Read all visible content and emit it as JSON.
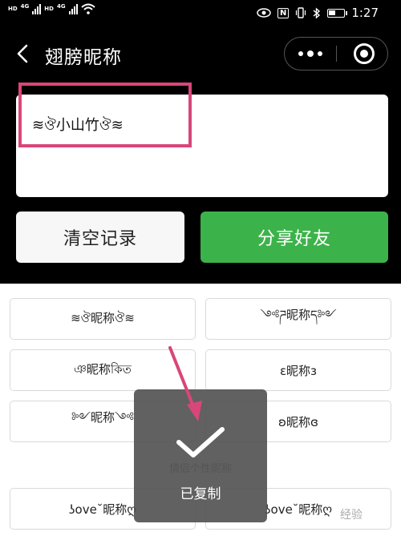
{
  "status_bar": {
    "sim1_hd": "HD",
    "sim1_net": "4G",
    "sim2_hd": "HD",
    "sim2_net": "4G",
    "time": "1:27",
    "nfc": "N"
  },
  "nav": {
    "title": "翅膀昵称"
  },
  "result": {
    "text": "≋ঔ小山竹ঔ≋"
  },
  "buttons": {
    "clear": "清空记录",
    "share": "分享好友"
  },
  "nicknames": [
    "≋ঔ昵称ঔ≋",
    "༺ཌ昵称ད༻",
    "ঞ昵称কিত",
    "ε昵称з",
    "༻昵称༺",
    "ʚ昵称ɞ",
    "",
    "",
    "ʖove˘昵称ღ",
    "ʖove˘昵称ღ"
  ],
  "toast": {
    "underlying": "情侣个性昵称",
    "message": "已复制"
  },
  "watermark": "经验",
  "colors": {
    "accent_green": "#3cb34a",
    "annotation_pink": "#d9467a"
  }
}
